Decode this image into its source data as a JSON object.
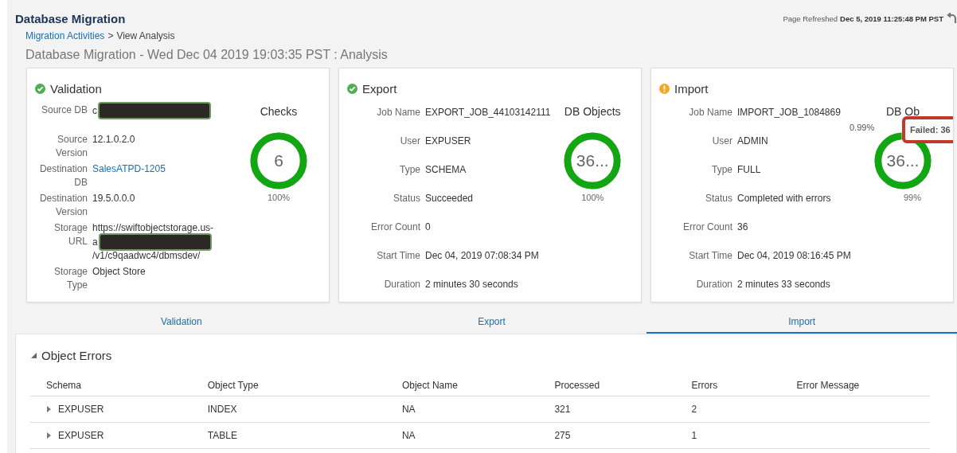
{
  "header": {
    "title": "Database Migration",
    "refreshed_label": "Page Refreshed",
    "refreshed_time": "Dec 5, 2019 11:25:48 PM PST",
    "breadcrumb": [
      {
        "text": "Migration Activities",
        "kind": "link"
      },
      {
        "text": ">",
        "kind": "separator"
      },
      {
        "text": "View Analysis",
        "kind": "current"
      }
    ],
    "subtitle": "Database Migration - Wed Dec 04 2019 19:03:35 PST : Analysis"
  },
  "cards": [
    {
      "title": "Validation",
      "icon": {
        "kind": "success"
      },
      "kind": "validation",
      "fields": [
        {
          "label": "Source DB",
          "kind": "text",
          "lines": [
            {
              "text": "c",
              "redacted": true
            }
          ]
        },
        {
          "label": "Source Version",
          "kind": "text",
          "lines": [
            {
              "text": "12.1.0.2.0",
              "redacted": false
            }
          ]
        },
        {
          "label": "Destination DB",
          "kind": "link",
          "lines": [
            {
              "text": "SalesATPD-1205",
              "redacted": false
            }
          ]
        },
        {
          "label": "Destination Version",
          "kind": "text",
          "lines": [
            {
              "text": "19.5.0.0.0",
              "redacted": false
            }
          ]
        },
        {
          "label": "Storage URL",
          "kind": "text",
          "lines": [
            {
              "text": "https://swiftobjectstorage.us-",
              "redacted": false
            },
            {
              "text": "a",
              "redacted": true
            },
            {
              "text": "/v1/c9qaadwc4/dbmsdev/",
              "redacted": false
            }
          ]
        },
        {
          "label": "Storage Type",
          "kind": "text",
          "lines": [
            {
              "text": "Object Store",
              "redacted": false
            }
          ]
        }
      ],
      "gauge": {
        "title": "Checks",
        "center": "6",
        "pass_label": "100%"
      }
    },
    {
      "title": "Export",
      "icon": {
        "kind": "success"
      },
      "kind": "job",
      "fields": [
        {
          "label": "Job Name",
          "kind": "text",
          "lines": [
            {
              "text": "EXPORT_JOB_44103142111",
              "redacted": false
            }
          ]
        },
        {
          "label": "User",
          "kind": "text",
          "lines": [
            {
              "text": "EXPUSER",
              "redacted": false
            }
          ]
        },
        {
          "label": "Type",
          "kind": "text",
          "lines": [
            {
              "text": "SCHEMA",
              "redacted": false
            }
          ]
        },
        {
          "label": "Status",
          "kind": "text",
          "lines": [
            {
              "text": "Succeeded",
              "redacted": false
            }
          ]
        },
        {
          "label": "Error Count",
          "kind": "text",
          "lines": [
            {
              "text": "0",
              "redacted": false
            }
          ]
        },
        {
          "label": "Start Time",
          "kind": "text",
          "lines": [
            {
              "text": "Dec 04, 2019 07:08:34 PM",
              "redacted": false
            }
          ]
        },
        {
          "label": "Duration",
          "kind": "text",
          "lines": [
            {
              "text": "2 minutes 30 seconds",
              "redacted": false
            }
          ]
        }
      ],
      "gauge": {
        "title": "DB Objects",
        "center": "36...",
        "pass_label": "100%"
      }
    },
    {
      "title": "Import",
      "icon": {
        "kind": "warning"
      },
      "kind": "job",
      "fields": [
        {
          "label": "Job Name",
          "kind": "text",
          "lines": [
            {
              "text": "IMPORT_JOB_1084869",
              "redacted": false
            }
          ]
        },
        {
          "label": "User",
          "kind": "text",
          "lines": [
            {
              "text": "ADMIN",
              "redacted": false
            }
          ]
        },
        {
          "label": "Type",
          "kind": "text",
          "lines": [
            {
              "text": "FULL",
              "redacted": false
            }
          ]
        },
        {
          "label": "Status",
          "kind": "text",
          "lines": [
            {
              "text": "Completed with errors",
              "redacted": false
            }
          ]
        },
        {
          "label": "Error Count",
          "kind": "text",
          "lines": [
            {
              "text": "36",
              "redacted": false
            }
          ]
        },
        {
          "label": "Start Time",
          "kind": "text",
          "lines": [
            {
              "text": "Dec 04, 2019 08:16:45 PM",
              "redacted": false
            }
          ]
        },
        {
          "label": "Duration",
          "kind": "text",
          "lines": [
            {
              "text": "2 minutes 33 seconds",
              "redacted": false
            }
          ]
        }
      ],
      "gauge": {
        "title": "DB Ob",
        "center": "36...",
        "pass_label": "99%",
        "fail_label": "0.99%",
        "tooltip": "Failed: 36"
      }
    }
  ],
  "tabs": [
    {
      "label": "Validation",
      "selected": false
    },
    {
      "label": "Export",
      "selected": false
    },
    {
      "label": "Import",
      "selected": true
    }
  ],
  "errors": {
    "title": "Object Errors",
    "expanded": true,
    "columns": [
      "Schema",
      "Object Type",
      "Object Name",
      "Processed",
      "Errors",
      "Error Message"
    ],
    "rows": [
      {
        "expanded": false,
        "cells": [
          "EXPUSER",
          "INDEX",
          "NA",
          "321",
          "2",
          ""
        ]
      },
      {
        "expanded": false,
        "cells": [
          "EXPUSER",
          "TABLE",
          "NA",
          "275",
          "1",
          ""
        ]
      }
    ]
  }
}
